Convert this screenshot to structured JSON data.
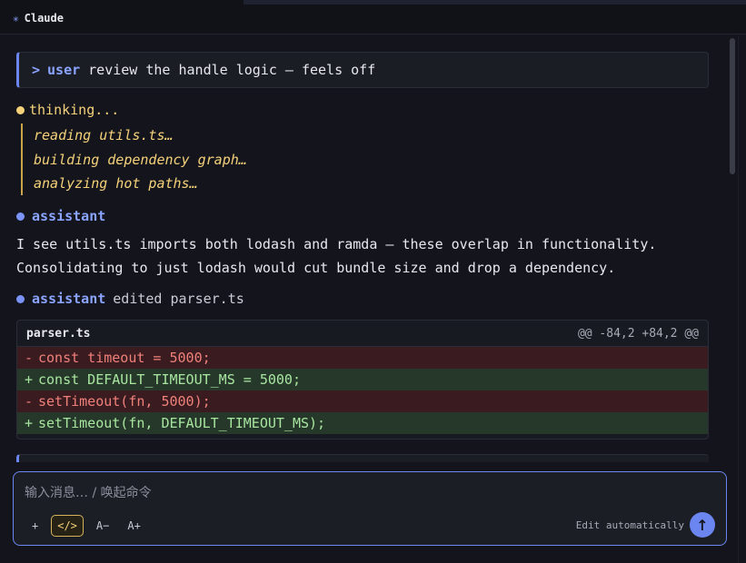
{
  "app": {
    "title": "Claude",
    "logo_icon": "✳"
  },
  "messages": {
    "user": {
      "prompt": ">",
      "who": "user",
      "text": "review the handle logic — feels off"
    },
    "thinking": {
      "label": "thinking...",
      "lines": [
        "reading utils.ts…",
        "building dependency graph…",
        "analyzing hot paths…"
      ]
    },
    "assistant1": {
      "who": "assistant",
      "text_line1": "I see utils.ts imports both lodash and ramda — these overlap in functionality.",
      "text_line2": "Consolidating to just lodash would cut bundle size and drop a dependency."
    },
    "assistant2": {
      "who": "assistant",
      "action": "edited parser.ts"
    }
  },
  "diff": {
    "file": "parser.ts",
    "hunk": "@@ -84,2 +84,2 @@",
    "lines": [
      {
        "type": "del",
        "sign": "-",
        "text": "const timeout = 5000;"
      },
      {
        "type": "add",
        "sign": "+",
        "text": "const DEFAULT_TIMEOUT_MS = 5000;"
      },
      {
        "type": "del",
        "sign": "-",
        "text": "setTimeout(fn, 5000);"
      },
      {
        "type": "add",
        "sign": "+",
        "text": "setTimeout(fn, DEFAULT_TIMEOUT_MS);"
      }
    ]
  },
  "composer": {
    "placeholder": "输入消息…  / 唤起命令",
    "tools": {
      "add": "+",
      "code": "</>",
      "font_down": "A−",
      "font_up": "A+"
    },
    "mode": "Edit automatically",
    "send": "↑"
  },
  "colors": {
    "accent": "#6b86f0",
    "thinking": "#f5d27a",
    "diff_del_bg": "#3a1c20",
    "diff_add_bg": "#26382a"
  }
}
